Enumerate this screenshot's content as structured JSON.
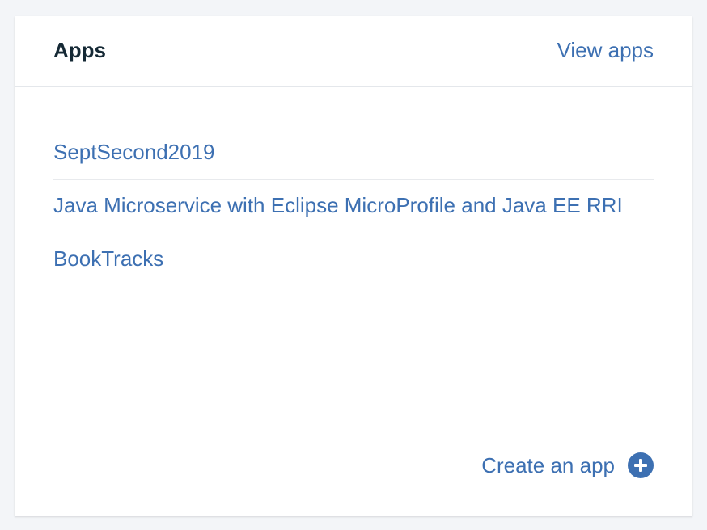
{
  "card": {
    "title": "Apps",
    "view_link": "View apps"
  },
  "apps": [
    {
      "label": "SeptSecond2019"
    },
    {
      "label": "Java Microservice with Eclipse MicroProfile and Java EE RRI"
    },
    {
      "label": "BookTracks"
    }
  ],
  "footer": {
    "create_label": "Create an app",
    "create_icon": "plus-circle-icon"
  },
  "colors": {
    "link": "#3d70b2",
    "title": "#152935",
    "background": "#f3f5f8",
    "card": "#ffffff"
  }
}
